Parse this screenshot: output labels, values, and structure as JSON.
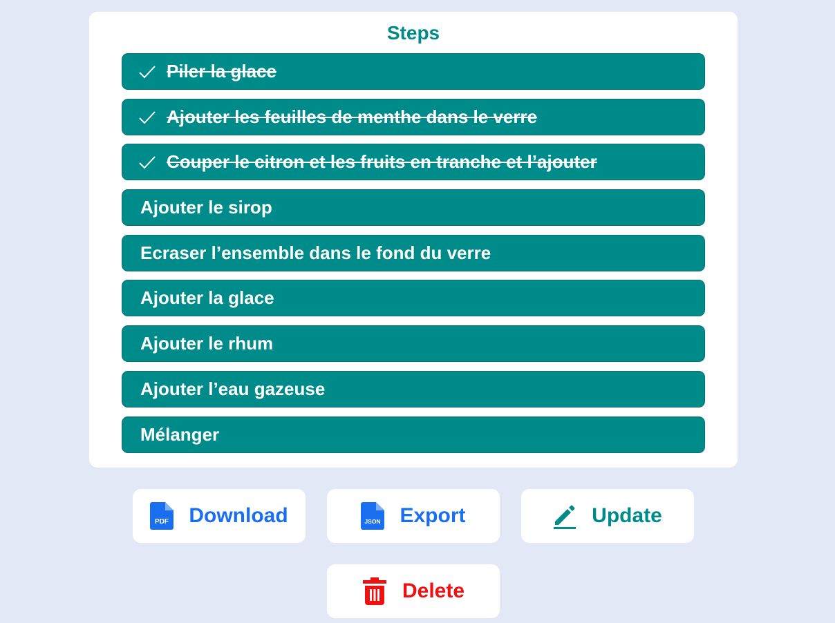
{
  "card": {
    "title": "Steps"
  },
  "steps": [
    {
      "label": "Piler la glace",
      "done": true
    },
    {
      "label": "Ajouter les feuilles de menthe dans le verre",
      "done": true
    },
    {
      "label": "Couper le citron et les fruits en tranche et l’ajouter",
      "done": true
    },
    {
      "label": "Ajouter le sirop",
      "done": false
    },
    {
      "label": "Ecraser l’ensemble dans le fond du verre",
      "done": false
    },
    {
      "label": "Ajouter la glace",
      "done": false
    },
    {
      "label": "Ajouter le rhum",
      "done": false
    },
    {
      "label": "Ajouter l’eau gazeuse",
      "done": false
    },
    {
      "label": "Mélanger",
      "done": false
    }
  ],
  "actions": {
    "download": {
      "label": "Download",
      "icon": "pdf-file-icon",
      "icon_text": "PDF"
    },
    "export": {
      "label": "Export",
      "icon": "json-file-icon",
      "icon_text": "JSON"
    },
    "update": {
      "label": "Update",
      "icon": "pencil-icon"
    },
    "delete": {
      "label": "Delete",
      "icon": "trash-icon"
    }
  },
  "colors": {
    "background": "#e3e8f6",
    "accent": "#008b8b",
    "link_blue": "#1a6ef0",
    "danger": "#ee1111"
  }
}
